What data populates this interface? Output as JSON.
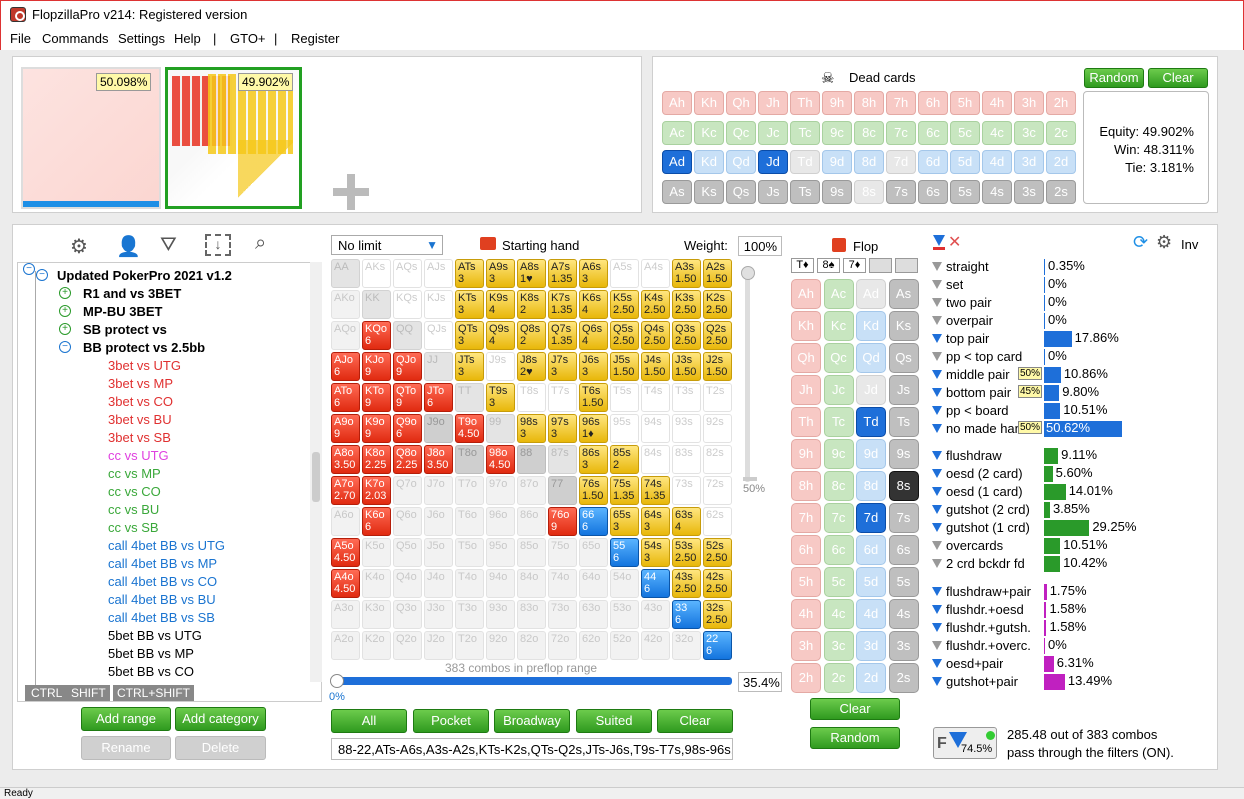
{
  "window_title": "FlopzillaPro v214: Registered version",
  "menu": [
    "File",
    "Commands",
    "Settings",
    "Help",
    "|",
    "GTO+",
    "|",
    "Register"
  ],
  "ranges": {
    "r1_pct": "50.098%",
    "r2_pct": "49.902%"
  },
  "dead_cards": {
    "title": "Dead cards",
    "random": "Random",
    "clear": "Clear",
    "rows": [
      [
        "Ah",
        "Kh",
        "Qh",
        "Jh",
        "Th",
        "9h",
        "8h",
        "7h",
        "6h",
        "5h",
        "4h",
        "3h",
        "2h"
      ],
      [
        "Ac",
        "Kc",
        "Qc",
        "Jc",
        "Tc",
        "9c",
        "8c",
        "7c",
        "6c",
        "5c",
        "4c",
        "3c",
        "2c"
      ],
      [
        "Ad",
        "Kd",
        "Qd",
        "Jd",
        "Td",
        "9d",
        "8d",
        "7d",
        "6d",
        "5d",
        "4d",
        "3d",
        "2d"
      ],
      [
        "As",
        "Ks",
        "Qs",
        "Js",
        "Ts",
        "9s",
        "8s",
        "7s",
        "6s",
        "5s",
        "4s",
        "3s",
        "2s"
      ]
    ],
    "equity": "Equity: 49.902%",
    "win": "Win: 48.311%",
    "tie": "Tie: 3.181%"
  },
  "tree": {
    "root": "Updated PokerPro 2021 v1.2",
    "groups": [
      "R1 and vs 3BET",
      "MP-BU 3BET",
      "SB protect vs",
      "BB protect vs 2.5bb"
    ],
    "items": [
      {
        "t": "3bet vs UTG",
        "c": "#e03030"
      },
      {
        "t": "3bet vs MP",
        "c": "#e03030"
      },
      {
        "t": "3bet vs CO",
        "c": "#e03030"
      },
      {
        "t": "3bet vs BU",
        "c": "#e03030"
      },
      {
        "t": "3bet vs SB",
        "c": "#e03030"
      },
      {
        "t": "cc vs UTG",
        "c": "#e040e0"
      },
      {
        "t": "cc vs MP",
        "c": "#3aa83a"
      },
      {
        "t": "cc vs CO",
        "c": "#3aa83a"
      },
      {
        "t": "cc vs BU",
        "c": "#3aa83a"
      },
      {
        "t": "cc vs SB",
        "c": "#3aa83a"
      },
      {
        "t": "call 4bet BB vs UTG",
        "c": "#1a74d0"
      },
      {
        "t": "call 4bet BB vs MP",
        "c": "#1a74d0"
      },
      {
        "t": "call 4bet BB vs CO",
        "c": "#1a74d0"
      },
      {
        "t": "call 4bet BB vs BU",
        "c": "#1a74d0"
      },
      {
        "t": "call 4bet BB vs SB",
        "c": "#1a74d0"
      },
      {
        "t": "5bet BB vs UTG",
        "c": "#000"
      },
      {
        "t": "5bet BB vs MP",
        "c": "#000"
      },
      {
        "t": "5bet BB vs CO",
        "c": "#000"
      }
    ],
    "keys": [
      "CTRL",
      "SHIFT",
      "CTRL+SHIFT"
    ],
    "add_range": "Add range",
    "add_category": "Add category",
    "rename": "Rename",
    "delete": "Delete"
  },
  "grid": {
    "limit": "No limit",
    "starting_hand": "Starting hand",
    "weight_label": "Weight:",
    "weight": "100%",
    "combos_text": "383 combos in preflop range",
    "slider_pct": "50%",
    "range_pct": "35.4%",
    "zero": "0%",
    "buttons": [
      "All",
      "Pocket",
      "Broadway",
      "Suited",
      "Clear"
    ],
    "range_text": "88-22,ATs-A6s,A3s-A2s,KTs-K2s,QTs-Q2s,JTs-J6s,T9s-T7s,98s-96s,8"
  },
  "flop": {
    "title": "Flop",
    "cards": [
      "T♦",
      "8♠",
      "7♦",
      "",
      ""
    ],
    "clear": "Clear",
    "random": "Random"
  },
  "stats": {
    "groups": [
      [
        {
          "n": "straight",
          "p": "0.35%",
          "v": 0.35
        },
        {
          "n": "set",
          "p": "0%",
          "v": 0
        },
        {
          "n": "two pair",
          "p": "0%",
          "v": 0
        },
        {
          "n": "overpair",
          "p": "0%",
          "v": 0
        },
        {
          "n": "top pair",
          "p": "17.86%",
          "v": 17.86
        },
        {
          "n": "pp < top card",
          "p": "0%",
          "v": 0
        },
        {
          "n": "middle pair",
          "p": "10.86%",
          "v": 10.86,
          "tag": "50%"
        },
        {
          "n": "bottom pair",
          "p": "9.80%",
          "v": 9.8,
          "tag": "45%"
        },
        {
          "n": "pp < board",
          "p": "10.51%",
          "v": 10.51
        },
        {
          "n": "no made hand",
          "p": "50.62%",
          "v": 50.62,
          "tag": "50%"
        }
      ],
      [
        {
          "n": "flushdraw",
          "p": "9.11%",
          "v": 9.11
        },
        {
          "n": "oesd (2 card)",
          "p": "5.60%",
          "v": 5.6
        },
        {
          "n": "oesd (1 card)",
          "p": "14.01%",
          "v": 14.01
        },
        {
          "n": "gutshot (2 crd)",
          "p": "3.85%",
          "v": 3.85
        },
        {
          "n": "gutshot (1 crd)",
          "p": "29.25%",
          "v": 29.25
        },
        {
          "n": "overcards",
          "p": "10.51%",
          "v": 10.51
        },
        {
          "n": "2 crd bckdr fd",
          "p": "10.42%",
          "v": 10.42
        }
      ],
      [
        {
          "n": "flushdraw+pair",
          "p": "1.75%",
          "v": 1.75
        },
        {
          "n": "flushdr.+oesd",
          "p": "1.58%",
          "v": 1.58
        },
        {
          "n": "flushdr.+gutsh.",
          "p": "1.58%",
          "v": 1.58
        },
        {
          "n": "flushdr.+overc.",
          "p": "0%",
          "v": 0
        },
        {
          "n": "oesd+pair",
          "p": "6.31%",
          "v": 6.31
        },
        {
          "n": "gutshot+pair",
          "p": "13.49%",
          "v": 13.49
        }
      ]
    ],
    "inv": "Inv",
    "filter_pct": "74.5%",
    "summary1": "285.48 out of 383 combos",
    "summary2": "pass through the filters (ON)."
  },
  "status": "Ready"
}
